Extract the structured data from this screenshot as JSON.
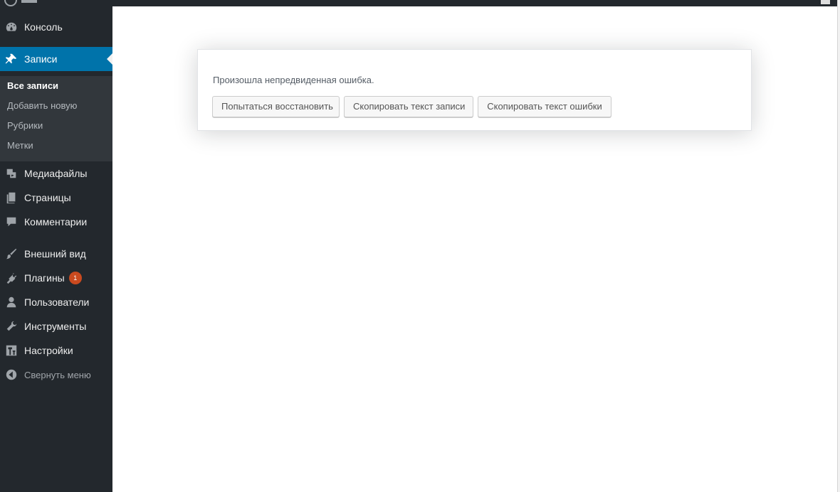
{
  "sidebar": {
    "console": {
      "label": "Консоль",
      "icon": "dashboard-icon"
    },
    "posts": {
      "label": "Записи",
      "icon": "pin-icon"
    },
    "posts_submenu": [
      "Все записи",
      "Добавить новую",
      "Рубрики",
      "Метки"
    ],
    "media": {
      "label": "Медиафайлы",
      "icon": "media-icon"
    },
    "pages": {
      "label": "Страницы",
      "icon": "pages-icon"
    },
    "comments": {
      "label": "Комментарии",
      "icon": "comments-icon"
    },
    "appearance": {
      "label": "Внешний вид",
      "icon": "brush-icon"
    },
    "plugins": {
      "label": "Плагины",
      "badge": "1",
      "icon": "plugin-icon"
    },
    "users": {
      "label": "Пользователи",
      "icon": "user-icon"
    },
    "tools": {
      "label": "Инструменты",
      "icon": "wrench-icon"
    },
    "settings": {
      "label": "Настройки",
      "icon": "settings-icon"
    },
    "collapse": {
      "label": "Свернуть меню",
      "icon": "collapse-icon"
    }
  },
  "error_box": {
    "message": "Произошла непредвиденная ошибка.",
    "btn_recover": "Попытаться восстановить",
    "btn_copy_post": "Скопировать текст записи",
    "btn_copy_error": "Скопировать текст ошибки"
  },
  "colors": {
    "sidebar_bg": "#23282d",
    "submenu_bg": "#32373c",
    "accent": "#0073aa",
    "badge": "#ca4a1f"
  }
}
